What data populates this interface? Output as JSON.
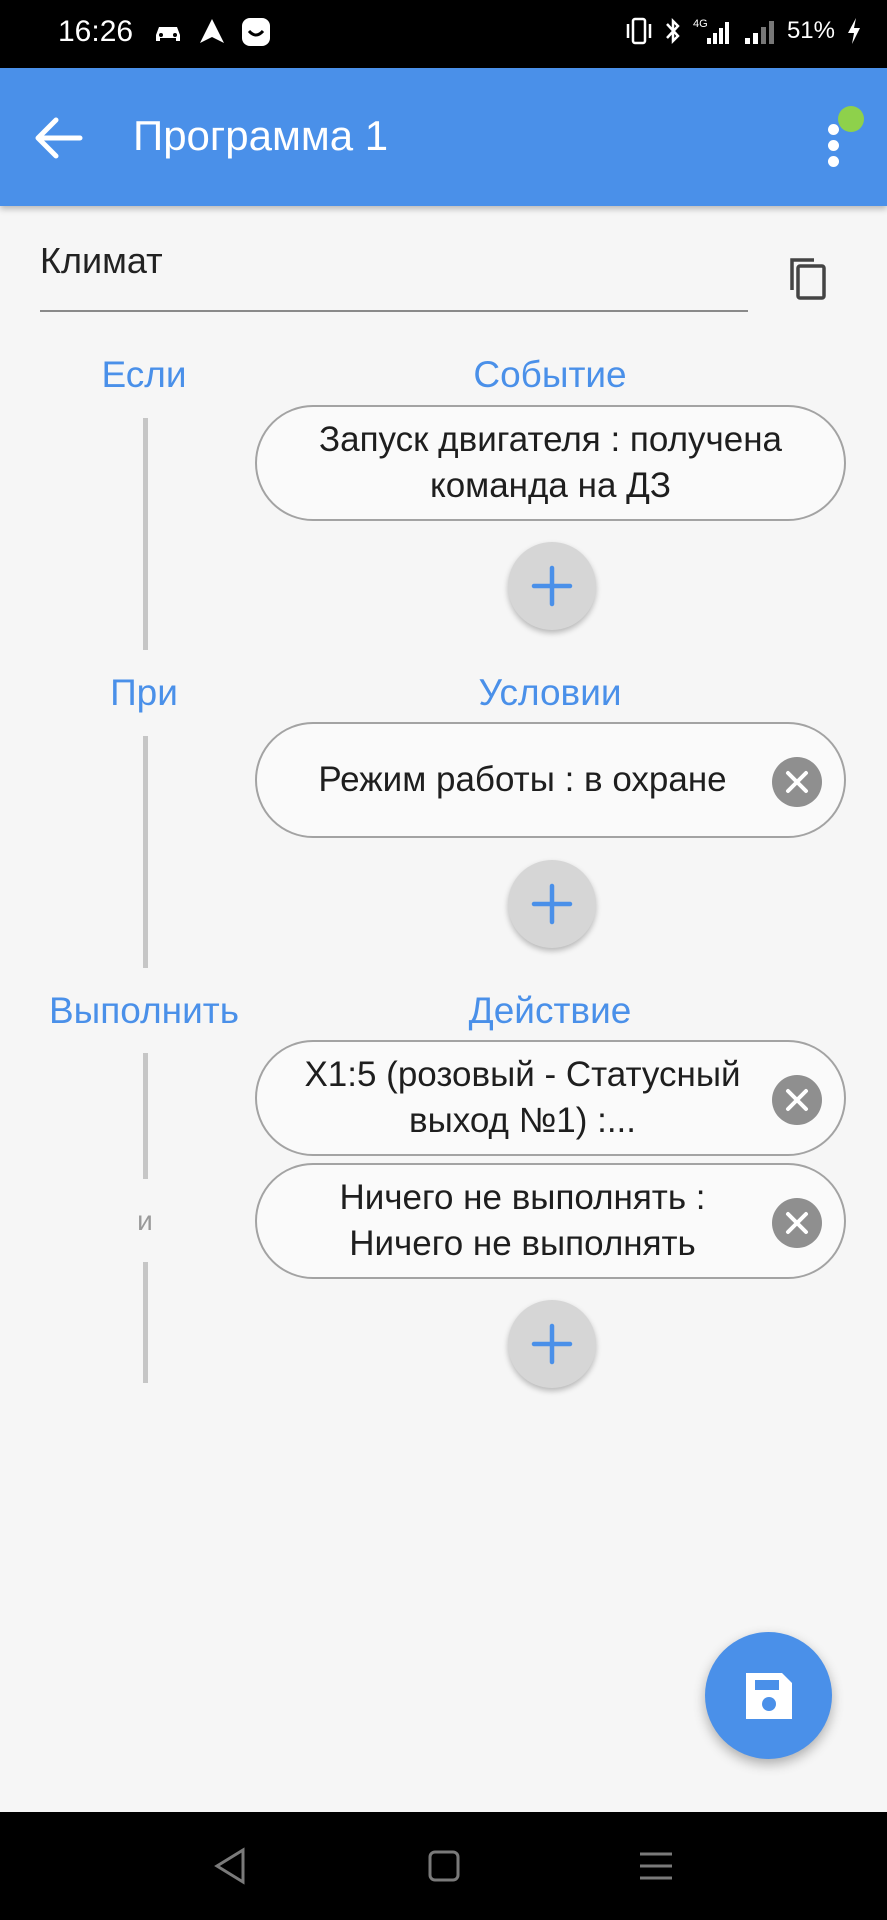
{
  "status_bar": {
    "time": "16:26",
    "battery": "51%",
    "icons_left": [
      "car-icon",
      "navigation-icon",
      "chat-app-icon"
    ],
    "icons_right": [
      "vibrate-icon",
      "bluetooth-icon",
      "4g-signal-icon",
      "signal-icon",
      "charging-icon"
    ]
  },
  "app_bar": {
    "title": "Программа 1",
    "back_icon": "arrow-back-icon",
    "menu_icon": "more-vert-icon",
    "status_color": "#8ed14b"
  },
  "program": {
    "name": "Климат"
  },
  "sections": {
    "if": {
      "label": "Если",
      "header": "Событие",
      "items": [
        {
          "text": "Запуск двигателя : получена команда на ДЗ"
        }
      ]
    },
    "when": {
      "label": "При",
      "header": "Условии",
      "items": [
        {
          "text": "Режим работы : в охране"
        }
      ]
    },
    "do": {
      "label": "Выполнить",
      "header": "Действие",
      "connector": "и",
      "items": [
        {
          "text": "X1:5 (розовый - Статусный выход №1) :..."
        },
        {
          "text": "Ничего не выполнять : Ничего не выполнять"
        }
      ]
    }
  },
  "colors": {
    "accent": "#4a90e9",
    "fab": "#4a90e9",
    "online": "#8ed14b"
  }
}
